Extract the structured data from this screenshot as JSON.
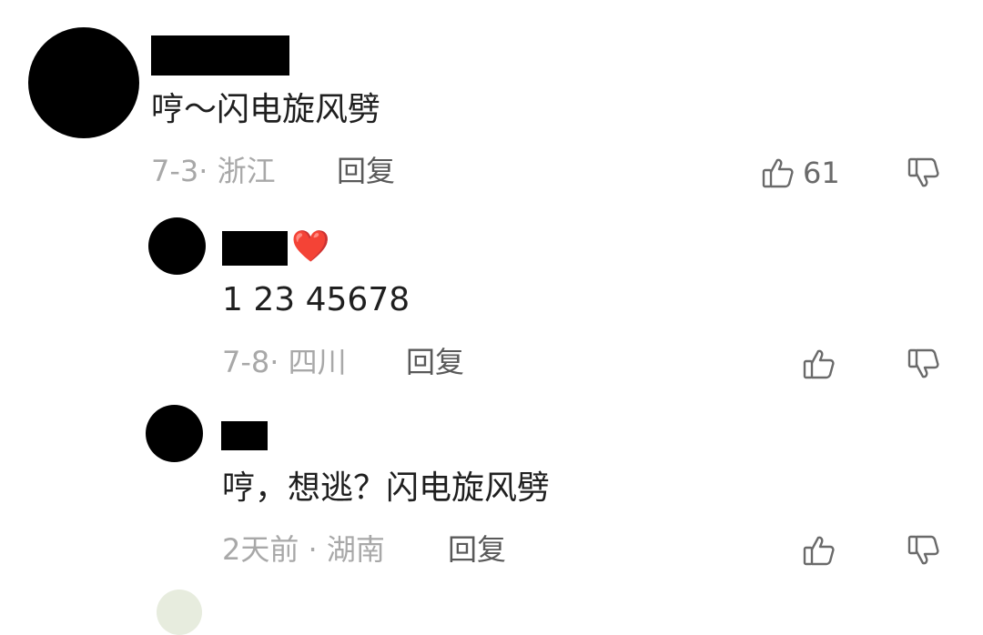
{
  "comments": [
    {
      "text": "哼～闪电旋风劈",
      "meta": "7-3· 浙江",
      "reply_label": "回复",
      "like_count": "61",
      "like_icon": "thumbs-up-outline",
      "dislike_icon": "thumbs-down-outline"
    },
    {
      "user_badge": "❤️",
      "text": "1 23 45678",
      "meta": "7-8· 四川",
      "reply_label": "回复",
      "like_icon": "thumbs-up-outline",
      "dislike_icon": "thumbs-down-outline"
    },
    {
      "text": "哼，想逃？闪电旋风劈",
      "meta": "2天前 · 湖南",
      "reply_label": "回复",
      "like_icon": "thumbs-up-outline",
      "dislike_icon": "thumbs-down-outline"
    }
  ],
  "colors": {
    "text_primary": "#1f1f1f",
    "text_meta": "#a8a8a8",
    "text_reply": "#595959",
    "icon_stroke": "#6a6a6a",
    "heart": "#e0202a"
  }
}
